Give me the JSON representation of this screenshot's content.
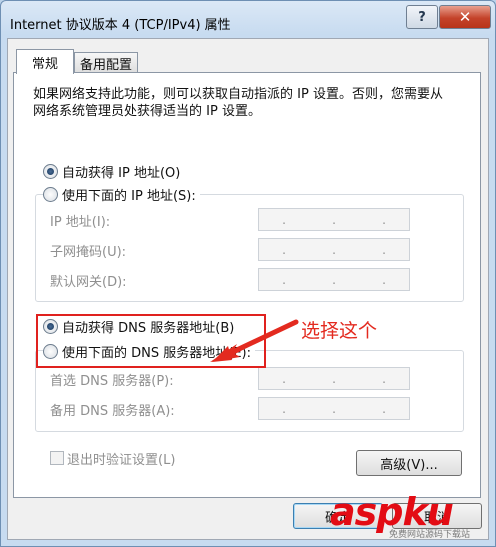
{
  "window": {
    "title": "Internet 协议版本 4 (TCP/IPv4) 属性",
    "help_label": "?",
    "close_label": "✕"
  },
  "tabs": [
    {
      "label": "常规"
    },
    {
      "label": "备用配置"
    }
  ],
  "general": {
    "description": "如果网络支持此功能，则可以获取自动指派的 IP 设置。否则，您需要从网络系统管理员处获得适当的 IP 设置。",
    "ip_auto": {
      "label": "自动获得 IP 地址(O)",
      "selected": true
    },
    "ip_manual": {
      "label": "使用下面的 IP 地址(S):",
      "selected": false
    },
    "ip_fields": [
      {
        "label": "IP 地址(I):",
        "value": ". . ."
      },
      {
        "label": "子网掩码(U):",
        "value": ". . ."
      },
      {
        "label": "默认网关(D):",
        "value": ". . ."
      }
    ],
    "dns_auto": {
      "label": "自动获得 DNS 服务器地址(B)",
      "selected": true
    },
    "dns_manual": {
      "label": "使用下面的 DNS 服务器地址(E):",
      "selected": false
    },
    "dns_fields": [
      {
        "label": "首选 DNS 服务器(P):",
        "value": ". . ."
      },
      {
        "label": "备用 DNS 服务器(A):",
        "value": ". . ."
      }
    ],
    "validate_checkbox": {
      "label": "退出时验证设置(L)",
      "checked": false
    },
    "advanced_button": "高级(V)..."
  },
  "footer": {
    "ok_button": "确定",
    "cancel_button": "取消"
  },
  "annotation": {
    "text": "选择这个",
    "color": "#e32a1f"
  },
  "watermark": {
    "brand": "aspku",
    "tagline": "免费网站源码下载站"
  }
}
